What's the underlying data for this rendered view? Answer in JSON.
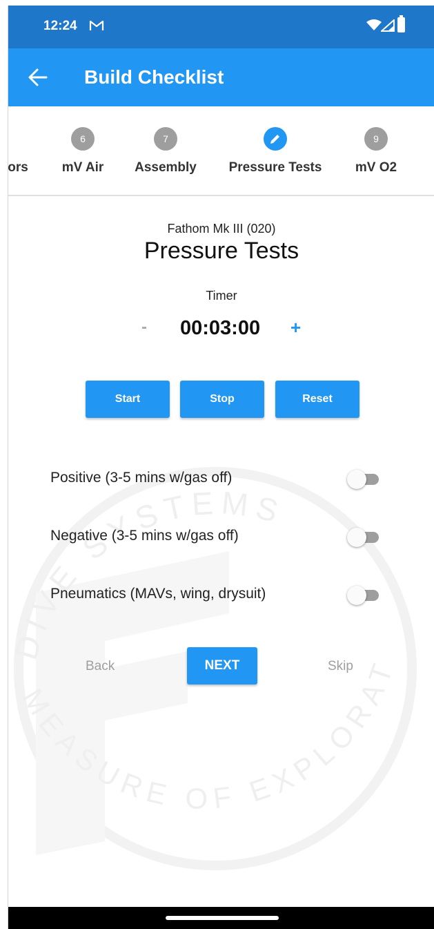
{
  "status_bar": {
    "time": "12:24"
  },
  "app_bar": {
    "title": "Build Checklist"
  },
  "steps": [
    {
      "number": "",
      "label": "ors"
    },
    {
      "number": "6",
      "label": "mV Air"
    },
    {
      "number": "7",
      "label": "Assembly"
    },
    {
      "number": "",
      "label": "Pressure Tests",
      "active": true,
      "icon": "pencil-icon"
    },
    {
      "number": "9",
      "label": "mV O2"
    }
  ],
  "content": {
    "device_name": "Fathom Mk III (020)",
    "title": "Pressure Tests",
    "timer_label": "Timer",
    "timer_minus": "-",
    "timer_value": "00:03:00",
    "timer_plus": "+"
  },
  "timer_buttons": {
    "start": "Start",
    "stop": "Stop",
    "reset": "Reset"
  },
  "checks": [
    {
      "label": "Positive (3-5 mins w/gas off)",
      "on": false
    },
    {
      "label": "Negative (3-5 mins w/gas off)",
      "on": false
    },
    {
      "label": "Pneumatics (MAVs, wing, drysuit)",
      "on": false
    }
  ],
  "navigation": {
    "back": "Back",
    "next": "NEXT",
    "skip": "Skip"
  },
  "watermark": {
    "top_text": "DIVE SYSTEMS",
    "bottom_text": "MEASURE OF EXPLORATION"
  },
  "colors": {
    "primary": "#2196f3",
    "status_bar": "#1f77c9",
    "inactive_step": "#9e9e9e"
  }
}
